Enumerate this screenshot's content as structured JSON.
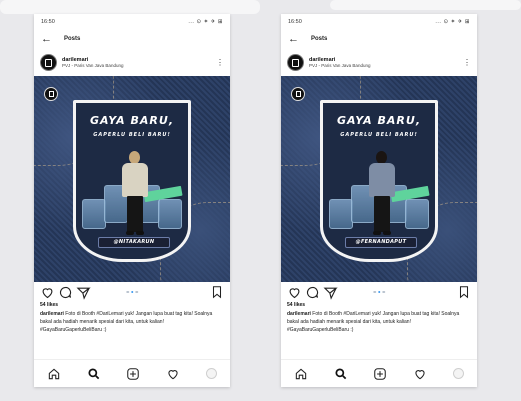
{
  "phones": [
    {
      "status": {
        "time": "16:50",
        "icons": "... ⊙ ✶ ✈ ⊞"
      },
      "topbar": {
        "back_icon": "arrow-left-icon",
        "title": "Posts"
      },
      "post": {
        "username": "darilemari",
        "location": "PVJ - Paris Van Java Bandung",
        "image": {
          "headline": "GAYA BARU,",
          "subline": "GAPERLU BELI BARU!",
          "name_tag": "@NITAKARUN",
          "person": "woman"
        },
        "carousel": {
          "count": 3,
          "active": 1
        },
        "likes": "54 likes",
        "caption_user": "darilemari",
        "caption_text": "Foto di Booth #DariLemari yuk! Jangan lupa buat tag kita! Soalnya bakal ada hadiah menarik spesial dari kita, untuk kalian! #GayaBaruGaperluBeliBaru :)"
      }
    },
    {
      "status": {
        "time": "16:50",
        "icons": "... ⊙ ✶ ✈ ⊞"
      },
      "topbar": {
        "back_icon": "arrow-left-icon",
        "title": "Posts"
      },
      "post": {
        "username": "darilemari",
        "location": "PVJ - Paris Van Java Bandung",
        "image": {
          "headline": "GAYA BARU,",
          "subline": "GAPERLU BELI BARU!",
          "name_tag": "@FERNANDAPUT",
          "person": "man"
        },
        "carousel": {
          "count": 3,
          "active": 1
        },
        "likes": "54 likes",
        "caption_user": "darilemari",
        "caption_text": "Foto di Booth #DariLemari yuk! Jangan lupa buat tag kita! Soalnya bakal ada hadiah menarik spesial dari kita, untuk kalian! #GayaBaruGaperluBeliBaru :)"
      }
    }
  ],
  "colors": {
    "accent": "#3897f0",
    "denim": "#2e4268",
    "promo_green": "#5fd39c"
  },
  "bottom_nav_icons": [
    "home-icon",
    "search-icon",
    "add-post-icon",
    "heart-icon",
    "profile-icon"
  ]
}
